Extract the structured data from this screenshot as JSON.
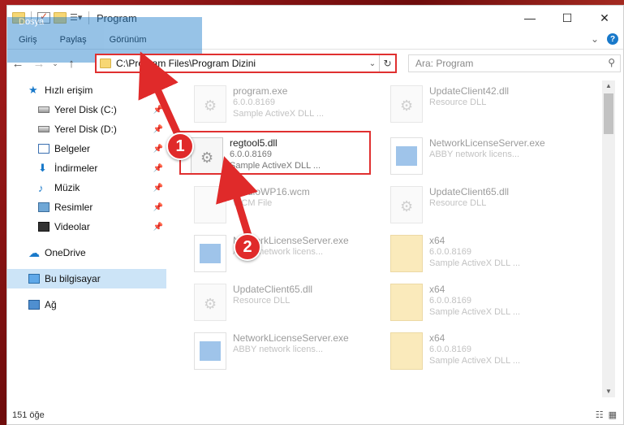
{
  "window": {
    "title": "Program",
    "controls": {
      "minimize": "—",
      "maximize": "☐",
      "close": "✕"
    }
  },
  "ribbon": {
    "tabs": [
      "Dosya",
      "Giriş",
      "Paylaş",
      "Görünüm"
    ]
  },
  "navbar": {
    "address": "C:\\Program Files\\Program Dizini",
    "search_placeholder": "Ara: Program"
  },
  "sidebar": {
    "items": [
      {
        "label": "Hızlı erişim",
        "icon": "star-icon",
        "pinned": false
      },
      {
        "label": "Yerel Disk (C:)",
        "icon": "disk-icon",
        "pinned": true
      },
      {
        "label": "Yerel Disk (D:)",
        "icon": "disk-icon",
        "pinned": true
      },
      {
        "label": "Belgeler",
        "icon": "documents-icon",
        "pinned": true
      },
      {
        "label": "İndirmeler",
        "icon": "download-icon",
        "pinned": true
      },
      {
        "label": "Müzik",
        "icon": "music-icon",
        "pinned": true
      },
      {
        "label": "Resimler",
        "icon": "pictures-icon",
        "pinned": true
      },
      {
        "label": "Videolar",
        "icon": "videos-icon",
        "pinned": true
      },
      {
        "label": "OneDrive",
        "icon": "cloud-icon",
        "pinned": false
      },
      {
        "label": "Bu bilgisayar",
        "icon": "computer-icon",
        "pinned": false
      },
      {
        "label": "Ağ",
        "icon": "network-icon",
        "pinned": false
      }
    ]
  },
  "files": [
    {
      "name": "program.exe",
      "line1": "6.0.0.8169",
      "line2": "Sample ActiveX DLL ...",
      "icon": "exe"
    },
    {
      "name": "UpdateClient42.dll",
      "line1": "Resource DLL",
      "line2": "",
      "icon": "dll"
    },
    {
      "name": "regtool5.dll",
      "line1": "6.0.0.8169",
      "line2": "Sample ActiveX DLL ...",
      "icon": "dll"
    },
    {
      "name": "NetworkLicenseServer.exe",
      "line1": "ABBY network licens...",
      "line2": "",
      "icon": "app"
    },
    {
      "name": "StudioWP16.wcm",
      "line1": "WCM File",
      "line2": "",
      "icon": "dll"
    },
    {
      "name": "UpdateClient65.dll",
      "line1": "Resource DLL",
      "line2": "",
      "icon": "dll"
    },
    {
      "name": "NetworkLicenseServer.exe",
      "line1": "ABBY network licens...",
      "line2": "",
      "icon": "app"
    },
    {
      "name": "x64",
      "line1": "6.0.0.8169",
      "line2": "Sample ActiveX DLL ...",
      "icon": "zip"
    },
    {
      "name": "UpdateClient65.dll",
      "line1": "Resource DLL",
      "line2": "",
      "icon": "dll"
    },
    {
      "name": "x64",
      "line1": "6.0.0.8169",
      "line2": "Sample ActiveX DLL ...",
      "icon": "zip"
    },
    {
      "name": "NetworkLicenseServer.exe",
      "line1": "ABBY network licens...",
      "line2": "",
      "icon": "app"
    },
    {
      "name": "x64",
      "line1": "6.0.0.8169",
      "line2": "Sample ActiveX DLL ...",
      "icon": "zip"
    }
  ],
  "status": {
    "count": "151 öğe"
  },
  "annotations": {
    "step1": "1",
    "step2": "2"
  },
  "colors": {
    "accent": "#1979ca",
    "annotation": "#e02a2a"
  }
}
